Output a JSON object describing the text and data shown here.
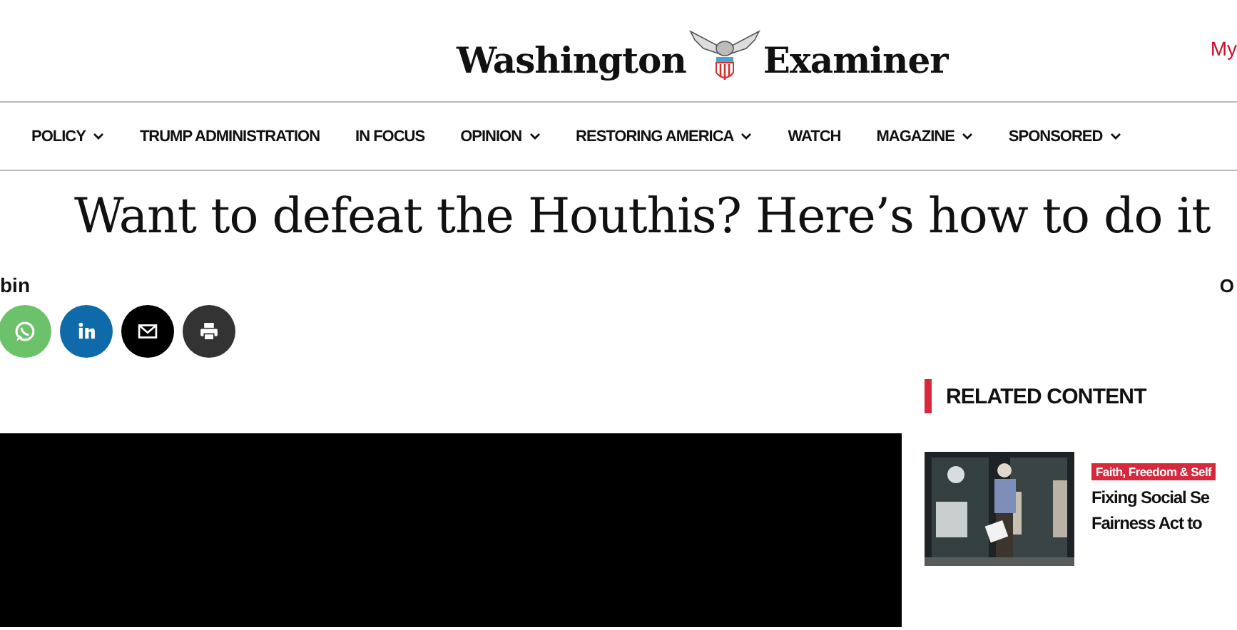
{
  "header": {
    "logo_left": "Washington",
    "logo_right": "Examiner",
    "account_link": "My"
  },
  "nav": [
    {
      "label": "POLICY",
      "dropdown": true
    },
    {
      "label": "TRUMP ADMINISTRATION",
      "dropdown": false
    },
    {
      "label": "IN FOCUS",
      "dropdown": false
    },
    {
      "label": "OPINION",
      "dropdown": true
    },
    {
      "label": "RESTORING AMERICA",
      "dropdown": true
    },
    {
      "label": "WATCH",
      "dropdown": false
    },
    {
      "label": "MAGAZINE",
      "dropdown": true
    },
    {
      "label": "SPONSORED",
      "dropdown": true
    }
  ],
  "article": {
    "title": "Want to defeat the Houthis? Here’s how to do it",
    "author": "bin",
    "meta": "O"
  },
  "share": [
    {
      "kind": "whatsapp"
    },
    {
      "kind": "linkedin"
    },
    {
      "kind": "email"
    },
    {
      "kind": "print"
    }
  ],
  "related": {
    "heading": "RELATED CONTENT",
    "items": [
      {
        "tag": "Faith, Freedom & Self",
        "headline": "Fixing Social Se Fairness Act to"
      }
    ]
  }
}
